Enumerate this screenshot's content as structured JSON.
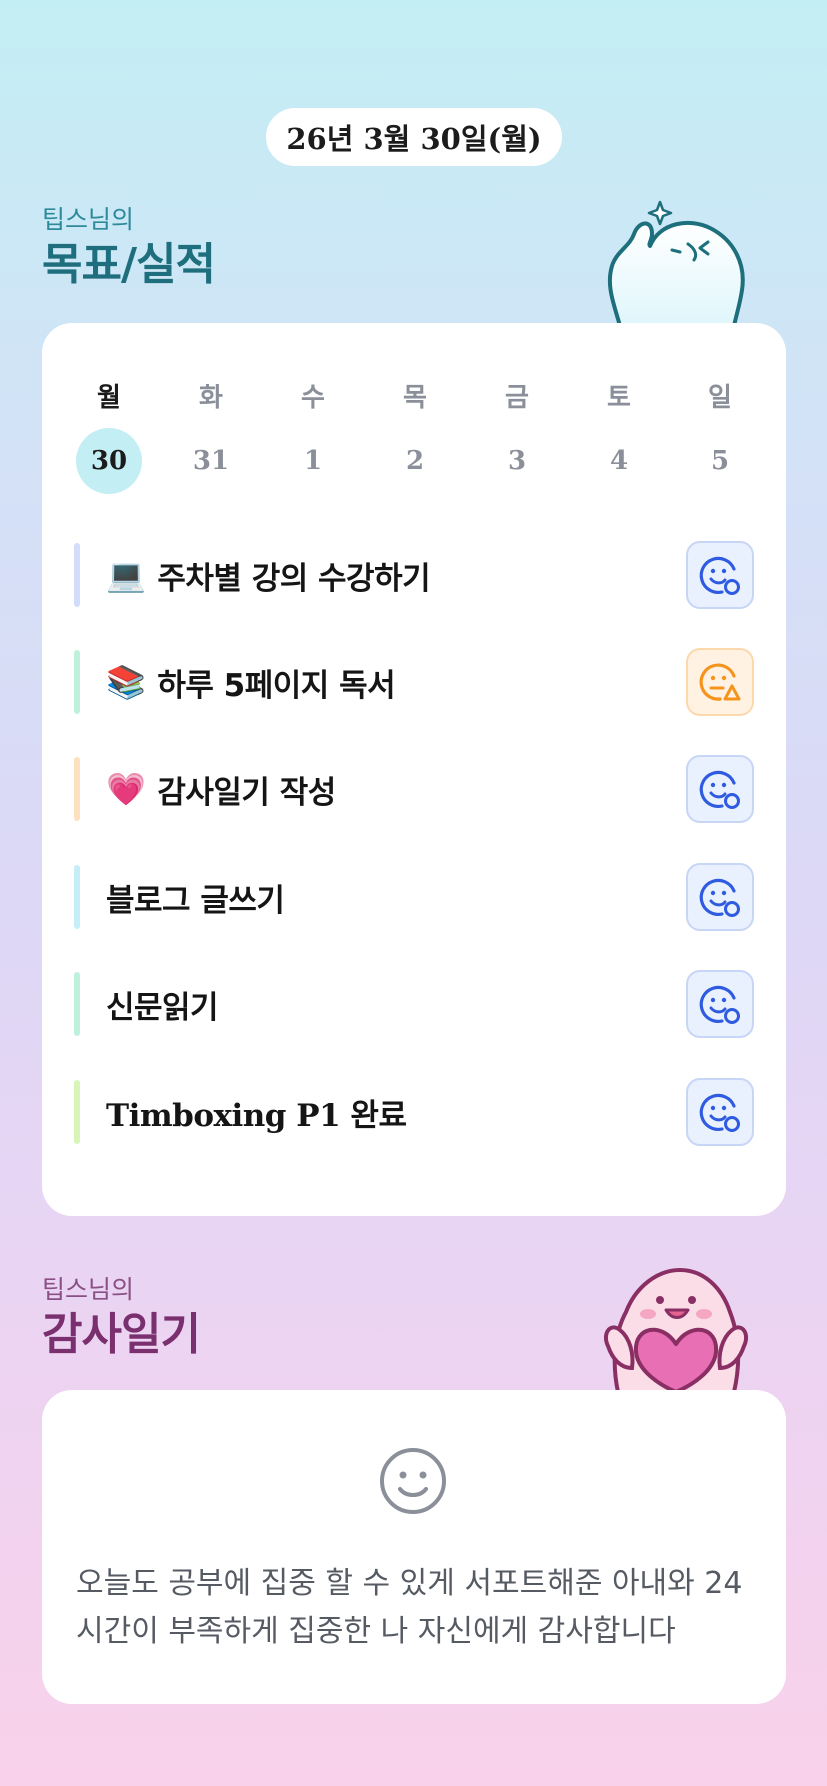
{
  "date_label": "26년 3월 30일(월)",
  "goals_section": {
    "subtitle": "팁스님의",
    "title": "목표/실적"
  },
  "week": {
    "days": [
      "월",
      "화",
      "수",
      "목",
      "금",
      "토",
      "일"
    ],
    "dates": [
      "30",
      "31",
      "1",
      "2",
      "3",
      "4",
      "5"
    ],
    "selected_index": 0
  },
  "goals": [
    {
      "emoji": "💻",
      "label": "주차별 강의 수강하기",
      "bar_color": "#d2dcfb",
      "status_icon": "smile-clock-icon",
      "status": "blue"
    },
    {
      "emoji": "📚",
      "label": "하루 5페이지 독서",
      "bar_color": "#bff0dc",
      "status_icon": "sad-warning-icon",
      "status": "orange"
    },
    {
      "emoji": "💗",
      "label": "감사일기 작성",
      "bar_color": "#fde0bf",
      "status_icon": "smile-clock-icon",
      "status": "blue"
    },
    {
      "emoji": "",
      "label": "블로그 글쓰기",
      "bar_color": "#c6eef6",
      "status_icon": "smile-clock-icon",
      "status": "blue"
    },
    {
      "emoji": "",
      "label": "신문읽기",
      "bar_color": "#bff0dc",
      "status_icon": "smile-clock-icon",
      "status": "blue"
    },
    {
      "emoji": "",
      "label": "Timboxing P1 완료",
      "bar_color": "#d7f5b6",
      "status_icon": "smile-clock-icon",
      "status": "blue"
    }
  ],
  "gratitude_section": {
    "subtitle": "팁스님의",
    "title": "감사일기"
  },
  "gratitude": {
    "icon": "smile-face-icon",
    "text": "오늘도 공부에 집중 할 수 있게 서포트해준 아내와 24 시간이 부족하게 집중한 나 자신에게 감사합니다"
  },
  "colors": {
    "accent_blue": "#2f5be0",
    "accent_orange": "#f5941d",
    "teal_title": "#1e6e7e",
    "plum_title": "#7a2f6e"
  }
}
